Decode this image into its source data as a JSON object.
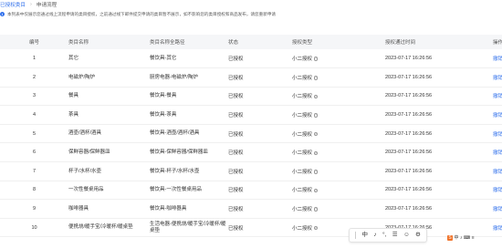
{
  "breadcrumb": {
    "parent": "已授权类目",
    "current": "申请流程",
    "separator": "›"
  },
  "notice": {
    "icon": "i",
    "text": "本列表中仅展示您通过线上流程申请的类目授权，之前通过线下邮件提交申请的类目暂不展示，如不影响您的类目授权和商品发布，请您重新申请"
  },
  "table": {
    "headers": [
      "编号",
      "类目名称",
      "类目名称全路径",
      "状态",
      "授权类型",
      "授权通过时间",
      "操作"
    ],
    "rows": [
      {
        "id": "1",
        "name": "其它",
        "path": "餐饮具-其它",
        "status": "已授权",
        "type": "小二授权",
        "time": "2023-07-17 16:26:56",
        "action": "撤销"
      },
      {
        "id": "2",
        "name": "电磁炉/陶炉",
        "path": "厨房电器-电磁炉/陶炉",
        "status": "已授权",
        "type": "小二授权",
        "time": "2023-07-17 16:26:56",
        "action": "撤销"
      },
      {
        "id": "3",
        "name": "餐具",
        "path": "餐饮具-餐具",
        "status": "已授权",
        "type": "小二授权",
        "time": "2023-07-17 16:26:56",
        "action": "撤销"
      },
      {
        "id": "4",
        "name": "茶具",
        "path": "餐饮具-茶具",
        "status": "已授权",
        "type": "小二授权",
        "time": "2023-07-17 16:26:56",
        "action": "撤销"
      },
      {
        "id": "5",
        "name": "酒壶/酒杯/酒具",
        "path": "餐饮具-酒壶/酒杯/酒具",
        "status": "已授权",
        "type": "小二授权",
        "time": "2023-07-17 16:26:56",
        "action": "撤销"
      },
      {
        "id": "6",
        "name": "保鲜容器/保鲜器皿",
        "path": "餐饮具-保鲜容器/保鲜器皿",
        "status": "已授权",
        "type": "小二授权",
        "time": "2023-07-17 16:26:56",
        "action": "撤销"
      },
      {
        "id": "7",
        "name": "杯子/水杯/水壶",
        "path": "餐饮具-杯子/水杯/水壶",
        "status": "已授权",
        "type": "小二授权",
        "time": "2023-07-17 16:26:56",
        "action": "撤销"
      },
      {
        "id": "8",
        "name": "一次性餐桌用品",
        "path": "餐饮具-一次性餐桌用品",
        "status": "已授权",
        "type": "小二授权",
        "time": "2023-07-17 16:26:56",
        "action": "撤销"
      },
      {
        "id": "9",
        "name": "咖啡器具",
        "path": "餐饮具-咖啡器具",
        "status": "已授权",
        "type": "小二授权",
        "time": "2023-07-17 16:26:56",
        "action": "撤销"
      },
      {
        "id": "10",
        "name": "便携烧/暖手宝/冷暖杯/暖桌垫",
        "path": "生活电器-便携烧/暖手宝/冷暖杯/暖桌垫",
        "status": "已授权",
        "type": "小二授权",
        "time": "2023-07-17 16:26:56",
        "action": "撤销"
      }
    ]
  },
  "ime_toolbar": {
    "items": [
      "中",
      "♪",
      "°,",
      "☰",
      "☺",
      "⚙"
    ]
  },
  "ime_side": {
    "logo": "S",
    "items": [
      "中",
      "♪",
      "⌨",
      "≡"
    ]
  }
}
